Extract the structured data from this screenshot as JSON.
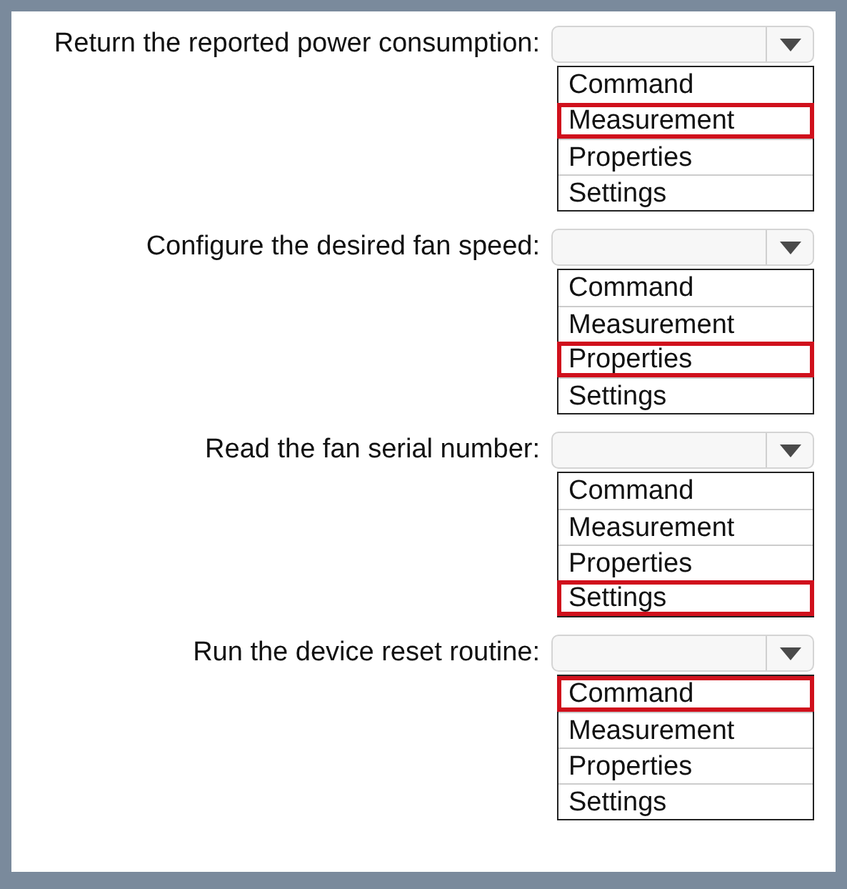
{
  "questions": [
    {
      "label": "Return the reported power consumption:",
      "options": [
        {
          "text": "Command",
          "selected": false
        },
        {
          "text": "Measurement",
          "selected": true
        },
        {
          "text": "Properties",
          "selected": false
        },
        {
          "text": "Settings",
          "selected": false
        }
      ]
    },
    {
      "label": "Configure the desired fan speed:",
      "options": [
        {
          "text": "Command",
          "selected": false
        },
        {
          "text": "Measurement",
          "selected": false
        },
        {
          "text": "Properties",
          "selected": true
        },
        {
          "text": "Settings",
          "selected": false
        }
      ]
    },
    {
      "label": "Read the fan serial number:",
      "options": [
        {
          "text": "Command",
          "selected": false
        },
        {
          "text": "Measurement",
          "selected": false
        },
        {
          "text": "Properties",
          "selected": false
        },
        {
          "text": "Settings",
          "selected": true
        }
      ]
    },
    {
      "label": "Run the device reset routine:",
      "options": [
        {
          "text": "Command",
          "selected": true
        },
        {
          "text": "Measurement",
          "selected": false
        },
        {
          "text": "Properties",
          "selected": false
        },
        {
          "text": "Settings",
          "selected": false
        }
      ]
    }
  ]
}
